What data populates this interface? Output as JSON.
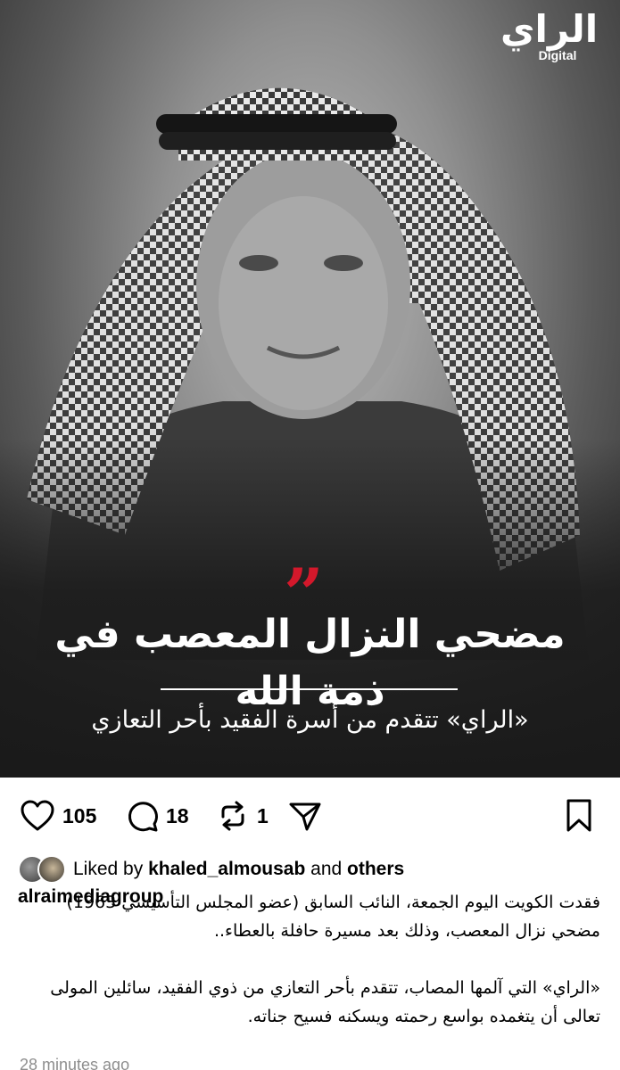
{
  "post_image": {
    "brand": {
      "mark": "الراي",
      "sub": "Digital"
    },
    "quote_mark": "”",
    "headline": "مضحي النزال المعصب في ذمة الله",
    "subline": "«الراي» تتقدم من أسرة الفقيد بأحر التعازي",
    "colors": {
      "accent": "#d3182b",
      "text": "#ffffff",
      "background": "#1a1a1a"
    }
  },
  "actions": {
    "like": {
      "icon": "heart-icon",
      "count": "105"
    },
    "comment": {
      "icon": "comment-bubble-icon",
      "count": "18"
    },
    "repost": {
      "icon": "repost-icon",
      "count": "1"
    },
    "share": {
      "icon": "paper-plane-icon"
    },
    "save": {
      "icon": "bookmark-icon"
    }
  },
  "likes": {
    "prefix": "Liked by",
    "user": "khaled_almousab",
    "middle": "and",
    "others": "others"
  },
  "caption": {
    "account": "alraimediagroup",
    "paragraph_1": "فقدت الكويت اليوم الجمعة، النائب السابق (عضو المجلس التأسيسي 1963) مضحي نزال المعصب، وذلك بعد مسيرة حافلة بالعطاء..",
    "paragraph_2": "«الراي» التي آلمها المصاب، تتقدم بأحر التعازي من ذوي الفقيد، سائلين المولى تعالى أن يتغمده بواسع رحمته ويسكنه فسيح جناته."
  },
  "timestamp": "28 minutes ago"
}
